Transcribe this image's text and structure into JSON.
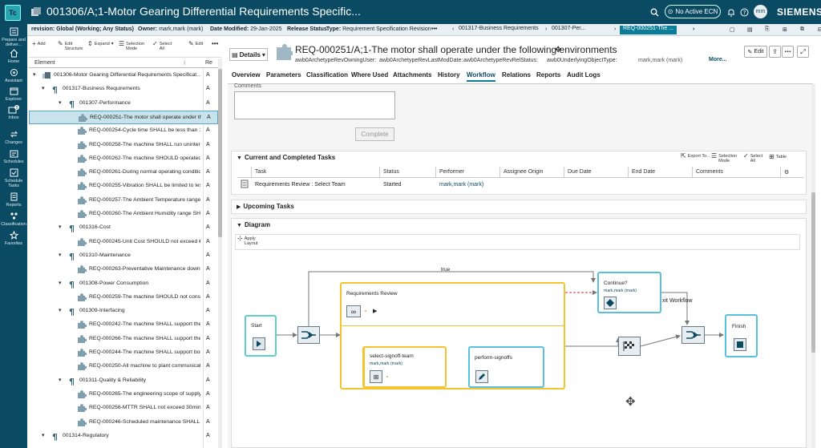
{
  "app": {
    "logo": "Tc",
    "window_title": "001306/A;1-Motor Gearing Differential Requirements Specific...",
    "ecn_label": "No Active ECN",
    "avatar_initials": "mm",
    "brand": "SIEMENS"
  },
  "leftnav": [
    {
      "label": "Prepare and deliver...",
      "icon": "prepare-icon"
    },
    {
      "label": "Home",
      "icon": "home-icon"
    },
    {
      "label": "Assistant",
      "icon": "assistant-icon"
    },
    {
      "label": "Explorer",
      "icon": "explorer-icon"
    },
    {
      "label": "Inbox",
      "icon": "inbox-icon",
      "badge": "5"
    },
    {
      "label": "Changes",
      "icon": "changes-icon"
    },
    {
      "label": "Schedules",
      "icon": "schedules-icon"
    },
    {
      "label": "Schedule Tasks",
      "icon": "schedule-tasks-icon"
    },
    {
      "label": "Reports",
      "icon": "reports-icon"
    },
    {
      "label": "Classification",
      "icon": "classification-icon"
    },
    {
      "label": "Favorites",
      "icon": "favorites-icon"
    }
  ],
  "context": {
    "revision_label": "revision:",
    "revision_value": "Global (Working; Any Status)",
    "owner_label": "Owner:",
    "owner_value": "mark,mark (mark)",
    "date_label": "Date Modified:",
    "date_value": "29-Jan-2025",
    "release_label": "Release Status:",
    "type_label": "Type:",
    "type_value": "Requirement Specification Revision",
    "more": "•••",
    "crumbs": [
      "001317-Business Requirements",
      "001307-Per...",
      "REQ-000251-The ..."
    ]
  },
  "left_toolbar": {
    "add": "Add",
    "edit_structure": "Edit Structure",
    "expand": "Expand",
    "selection_mode": "Selection Mode",
    "select_all": "Select All",
    "edit": "Edit",
    "more": "•••"
  },
  "tree": {
    "col_element": "Element",
    "col_rev": "Re",
    "rows": [
      {
        "label": "001306-Motor Gearing Differential Requirements Specificat...",
        "rev": "A",
        "level": 0,
        "kind": "spec",
        "caret": "▾"
      },
      {
        "label": "001317-Business Requirements",
        "rev": "A",
        "level": 1,
        "kind": "para",
        "caret": "▾"
      },
      {
        "label": "001307-Performance",
        "rev": "A",
        "level": 2,
        "kind": "para",
        "caret": "▾"
      },
      {
        "label": "REQ-000251-The motor shall operate under the fo...",
        "rev": "A",
        "level": 3,
        "kind": "req",
        "caret": ""
      },
      {
        "label": "REQ-000254-Cycle time SHALL be less than 120sec",
        "rev": "A",
        "level": 3,
        "kind": "req",
        "caret": ""
      },
      {
        "label": "REQ-000258-The machine SHALL run uninterrupte...",
        "rev": "A",
        "level": 3,
        "kind": "req",
        "caret": ""
      },
      {
        "label": "REQ-000262-The machine SHOULD operated unat...",
        "rev": "A",
        "level": 3,
        "kind": "req",
        "caret": ""
      },
      {
        "label": "REQ-000261-During normal operating conditions ...",
        "rev": "A",
        "level": 3,
        "kind": "req",
        "caret": ""
      },
      {
        "label": "REQ-000255-Vibration SHALL be limited to less th...",
        "rev": "A",
        "level": 3,
        "kind": "req",
        "caret": ""
      },
      {
        "label": "REQ-000257-The Ambient Temperature range SH...",
        "rev": "A",
        "level": 3,
        "kind": "req",
        "caret": ""
      },
      {
        "label": "REQ-000260-The Ambient Humidity range SHALL ...",
        "rev": "A",
        "level": 3,
        "kind": "req",
        "caret": ""
      },
      {
        "label": "001316-Cost",
        "rev": "A",
        "level": 2,
        "kind": "para",
        "caret": "▾"
      },
      {
        "label": "REQ-000245-Unit Cost SHOULD not exceed €24,000",
        "rev": "A",
        "level": 3,
        "kind": "req",
        "caret": ""
      },
      {
        "label": "001310-Maintenance",
        "rev": "A",
        "level": 2,
        "kind": "para",
        "caret": "▾"
      },
      {
        "label": "REQ-000263-Preventative Maintenance downtime ...",
        "rev": "A",
        "level": 3,
        "kind": "req",
        "caret": ""
      },
      {
        "label": "001308-Power Consumption",
        "rev": "A",
        "level": 2,
        "kind": "para",
        "caret": "▾"
      },
      {
        "label": "REQ-000259-The machine SHOULD not consume ...",
        "rev": "A",
        "level": 3,
        "kind": "req",
        "caret": ""
      },
      {
        "label": "001309-Interfacing",
        "rev": "A",
        "level": 2,
        "kind": "para",
        "caret": "▾"
      },
      {
        "label": "REQ-000242-The machine SHALL support the EN4...",
        "rev": "A",
        "level": 3,
        "kind": "req",
        "caret": ""
      },
      {
        "label": "REQ-000266-The machine SHALL support the ISO...",
        "rev": "A",
        "level": 3,
        "kind": "req",
        "caret": ""
      },
      {
        "label": "REQ-000244-The machine SHALL support both 23...",
        "rev": "A",
        "level": 3,
        "kind": "req",
        "caret": ""
      },
      {
        "label": "REQ-000250-All machine to plant communication ...",
        "rev": "A",
        "level": 3,
        "kind": "req",
        "caret": ""
      },
      {
        "label": "001311-Quality & Reliability",
        "rev": "A",
        "level": 2,
        "kind": "para",
        "caret": "▾"
      },
      {
        "label": "REQ-000265-The engineering scope of supply SH...",
        "rev": "A",
        "level": 3,
        "kind": "req",
        "caret": ""
      },
      {
        "label": "REQ-000256-MTTR SHALL not exceed 30minutes",
        "rev": "A",
        "level": 3,
        "kind": "req",
        "caret": ""
      },
      {
        "label": "REQ-000246-Scheduled maintenance SHALL be o...",
        "rev": "A",
        "level": 3,
        "kind": "req",
        "caret": ""
      },
      {
        "label": "001314-Regulatory",
        "rev": "A",
        "level": 1,
        "kind": "para",
        "caret": "▾"
      }
    ]
  },
  "detail": {
    "details_button": "Details",
    "title": "REQ-000251/A;1-The motor shall operate under the following environments",
    "props": [
      "awb0ArchetypeRevOwningUser:",
      "awb0ArchetypeRevLastModDate:",
      "awb0ArchetypeRevRelStatus:",
      "awb0UnderlyingObjectType:",
      "mark,mark (mark)"
    ],
    "more": "More...",
    "edit": "Edit",
    "tabs": [
      "Overview",
      "Parameters",
      "Classification",
      "Where Used",
      "Attachments",
      "History",
      "Workflow",
      "Relations",
      "Reports",
      "Audit Logs"
    ],
    "active_tab": "Workflow"
  },
  "workflow": {
    "comments_label": "Comments",
    "complete_button": "Complete",
    "tasks_section": "Current and Completed Tasks",
    "tasks_toolbar": {
      "export": "Export To...",
      "selection_mode": "Selection Mode",
      "select_all": "Select All",
      "table": "Table"
    },
    "columns": [
      "Task",
      "Status",
      "Performer",
      "Assignee Origin",
      "Due Date",
      "End Date",
      "Comments"
    ],
    "rows": [
      {
        "task": "Requirements Review : Select Team",
        "status": "Started",
        "performer": "mark,mark (mark)",
        "origin": "",
        "due": "",
        "end": "",
        "comments": ""
      }
    ],
    "upcoming_section": "Upcoming Tasks",
    "diagram_section": "Diagram",
    "apply_layout": "Apply Layout"
  },
  "diagram": {
    "start": "Start",
    "requirements_review": "Requirements Review",
    "select_signoff": "select-signoff-team",
    "performer": "mark,mark (mark)",
    "perform_signoffs": "perform-signoffs",
    "continue": "Continue?",
    "finish": "Finish",
    "true_label": "true",
    "exit_label": "xit Workflow",
    "colors": {
      "teal": "#5fd0c8",
      "yellow": "#f4c430",
      "blue": "#5bc0de"
    }
  }
}
